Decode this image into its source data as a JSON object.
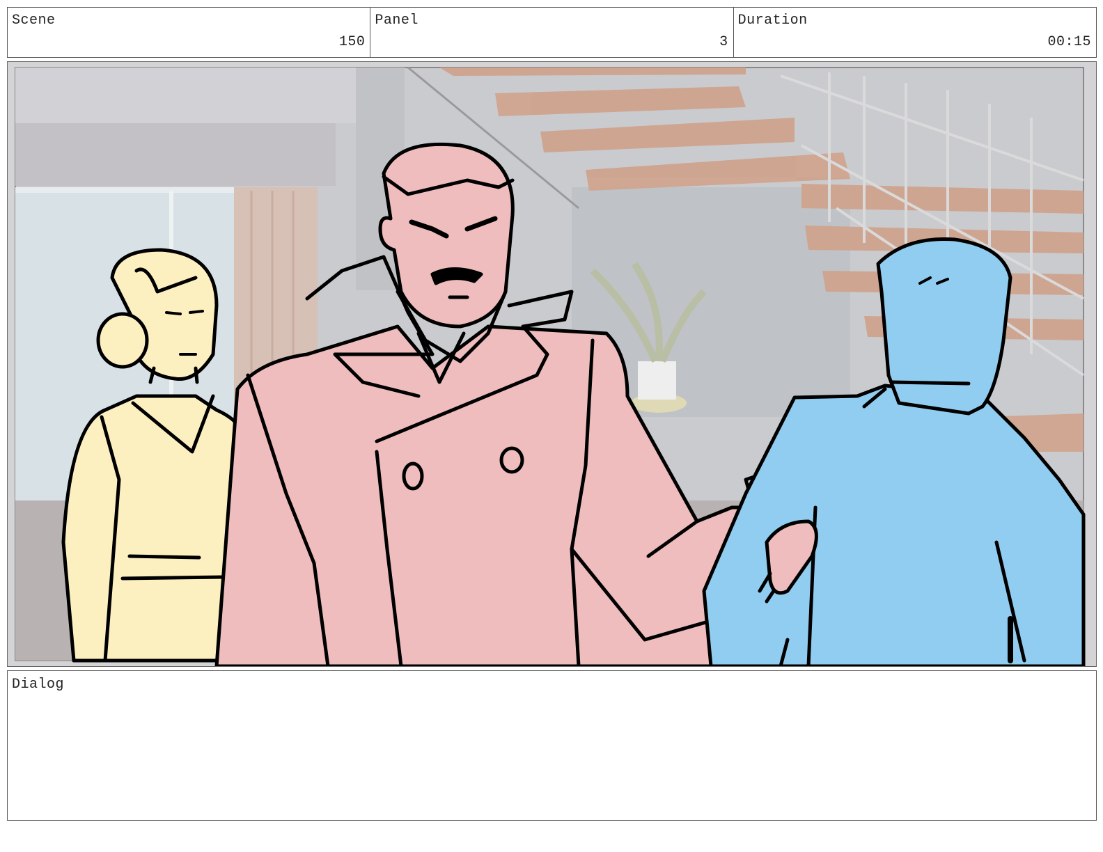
{
  "header": {
    "scene_label": "Scene",
    "scene_value": "150",
    "panel_label": "Panel",
    "panel_value": "3",
    "duration_label": "Duration",
    "duration_value": "00:15"
  },
  "dialog": {
    "label": "Dialog",
    "text": ""
  },
  "colors": {
    "woman": "#fdf0c0",
    "man_center": "#efbdbd",
    "man_right": "#90cdf0",
    "stairs": "#c89a82",
    "background": "#cfcfcf"
  }
}
